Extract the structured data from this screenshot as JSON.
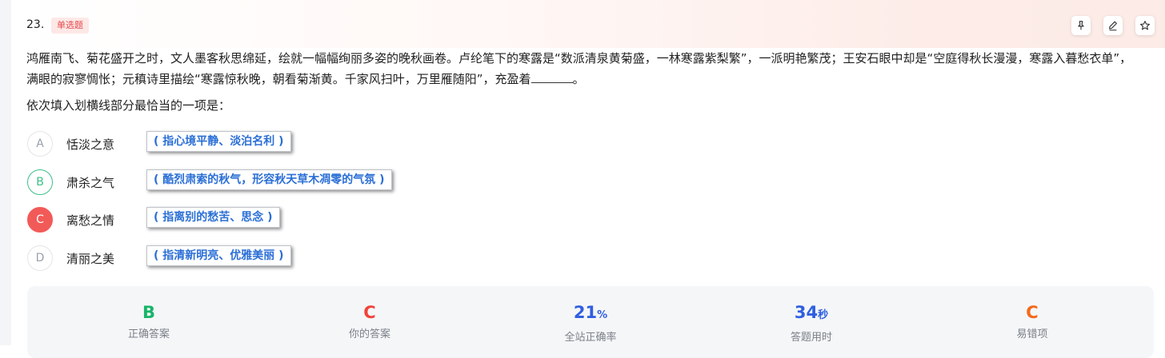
{
  "question": {
    "number": "23.",
    "type_badge": "单选题",
    "stem": "鸿雁南飞、菊花盛开之时，文人墨客秋思绵延，绘就一幅幅绚丽多姿的晚秋画卷。卢纶笔下的寒露是“数派清泉黄菊盛，一林寒露紫梨繁”，一派明艳繁茂；王安石眼中却是“空庭得秋长漫漫，寒露入暮愁衣单”，满眼的寂寥惆怅；元稹诗里描绘“寒露惊秋晚，朝看菊渐黄。千家风扫叶，万里雁随阳”，充盈着",
    "stem_end": "。",
    "ask": "依次填入划横线部分最恰当的一项是："
  },
  "toolbar": {
    "icons": [
      "pin-icon",
      "edit-icon",
      "star-icon"
    ]
  },
  "options": [
    {
      "letter": "A",
      "text": "恬淡之意",
      "note": "( 指心境平静、淡泊名利 )",
      "state": "default"
    },
    {
      "letter": "B",
      "text": "肃杀之气",
      "note": "( 酷烈肃索的秋气，形容秋天草木凋零的气氛 )",
      "state": "correct"
    },
    {
      "letter": "C",
      "text": "离愁之情",
      "note": "( 指离别的愁苦、思念 )",
      "state": "wrong"
    },
    {
      "letter": "D",
      "text": "清丽之美",
      "note": "( 指清新明亮、优雅美丽 )",
      "state": "default"
    }
  ],
  "stats": {
    "correct_answer": {
      "value": "B",
      "label": "正确答案",
      "color": "#19b56b"
    },
    "your_answer": {
      "value": "C",
      "label": "你的答案",
      "color": "#f0433a"
    },
    "accuracy": {
      "value": "21",
      "unit": "%",
      "label": "全站正确率",
      "color": "#2f5fe0"
    },
    "time_used": {
      "value": "34",
      "unit": "秒",
      "label": "答题用时",
      "color": "#2f5fe0"
    },
    "common_wrong": {
      "value": "C",
      "label": "易错项",
      "color": "#f26a1b"
    }
  }
}
